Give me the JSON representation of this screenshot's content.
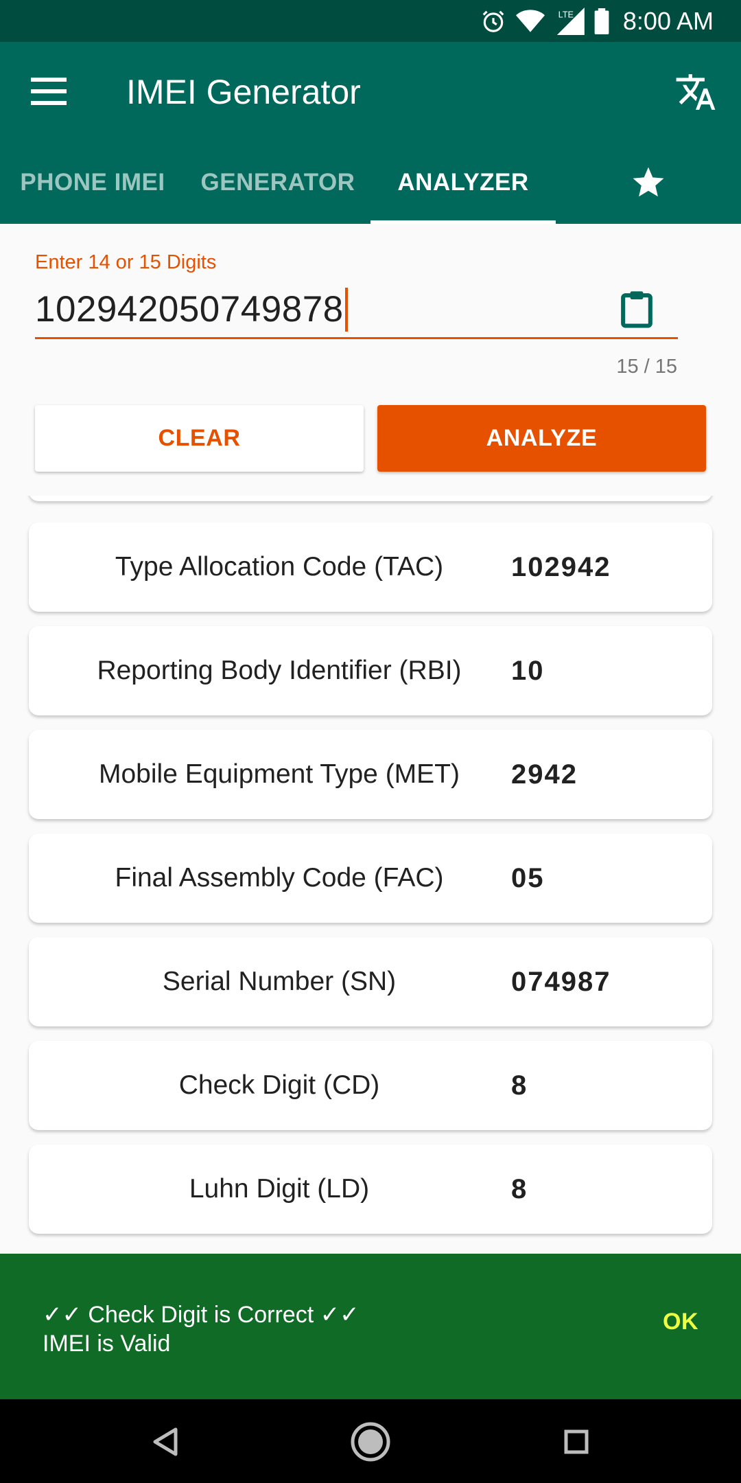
{
  "status_bar": {
    "time": "8:00 AM",
    "network": "LTE"
  },
  "app_bar": {
    "title": "IMEI Generator",
    "menu_icon": "menu-icon",
    "translate_icon": "translate-icon"
  },
  "tabs": [
    {
      "label": "PHONE IMEI"
    },
    {
      "label": "GENERATOR"
    },
    {
      "label": "ANALYZER"
    },
    {
      "icon": "star-icon"
    }
  ],
  "input": {
    "label": "Enter 14 or 15 Digits",
    "value": "102942050749878",
    "counter": "15 / 15"
  },
  "buttons": {
    "clear": "CLEAR",
    "analyze": "ANALYZE"
  },
  "results": [
    {
      "label": "Type Allocation Code (TAC)",
      "value": "102942"
    },
    {
      "label": "Reporting Body Identifier (RBI)",
      "value": "10"
    },
    {
      "label": "Mobile Equipment Type (MET)",
      "value": "2942"
    },
    {
      "label": "Final Assembly Code (FAC)",
      "value": "05"
    },
    {
      "label": "Serial Number (SN)",
      "value": "074987"
    },
    {
      "label": "Check Digit (CD)",
      "value": "8"
    },
    {
      "label": "Luhn Digit (LD)",
      "value": "8"
    }
  ],
  "snackbar": {
    "line1": "✓✓ Check Digit is Correct ✓✓",
    "line2": "IMEI is Valid",
    "action": "OK"
  },
  "colors": {
    "primary": "#00695c",
    "primary_dark": "#004d40",
    "accent": "#e65100",
    "snackbar": "#0f6b26",
    "snackbar_action": "#eeff41"
  }
}
